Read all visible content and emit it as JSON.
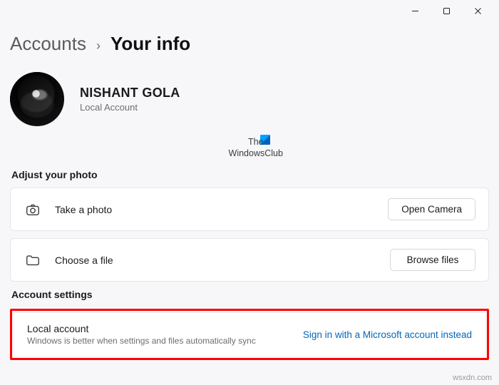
{
  "breadcrumb": {
    "parent": "Accounts",
    "current": "Your info"
  },
  "user": {
    "name": "NISHANT GOLA",
    "type": "Local Account"
  },
  "watermark": {
    "line1": "The",
    "line2": "WindowsClub"
  },
  "sections": {
    "adjust_photo_title": "Adjust your photo",
    "account_settings_title": "Account settings"
  },
  "photo_rows": {
    "take_photo": {
      "label": "Take a photo",
      "button": "Open Camera"
    },
    "choose_file": {
      "label": "Choose a file",
      "button": "Browse files"
    }
  },
  "account_row": {
    "title": "Local account",
    "desc": "Windows is better when settings and files automatically sync",
    "link": "Sign in with a Microsoft account instead"
  },
  "footer": "wsxdn.com"
}
